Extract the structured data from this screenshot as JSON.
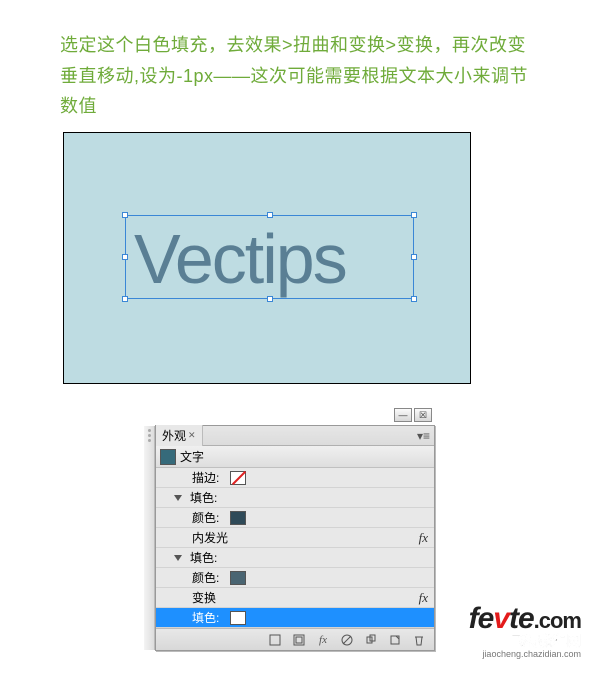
{
  "instruction": "选定这个白色填充，去效果>扭曲和变换>变换，再次改变垂直移动,设为-1px——这次可能需要根据文本大小来调节数值",
  "artboard": {
    "text": "Vectips"
  },
  "panel": {
    "tab": "外观",
    "header": "文字",
    "rows": {
      "stroke": "描边:",
      "fill1": "填色:",
      "color1": "颜色:",
      "inner_glow": "内发光",
      "fill2": "填色:",
      "color2": "颜色:",
      "transform": "变换",
      "fill3": "填色:"
    }
  },
  "watermark": {
    "brand_pre": "fe",
    "brand_v": "v",
    "brand_post": "te",
    "brand_dot": ".com",
    "sub": "飞特教程网",
    "url": "jiaocheng.chazidian.com"
  }
}
